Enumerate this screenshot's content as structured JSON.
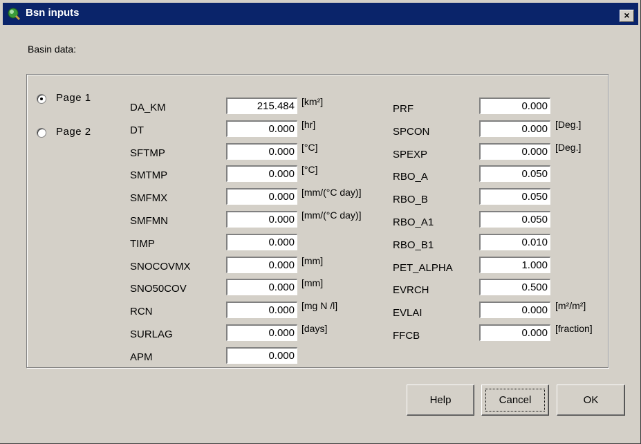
{
  "window": {
    "title": "Bsn inputs",
    "close_glyph": "×",
    "icon": "app-icon"
  },
  "basin_label": "Basin data:",
  "pages": [
    {
      "label": "Page 1",
      "selected": true
    },
    {
      "label": "Page 2",
      "selected": false
    }
  ],
  "left_params": [
    {
      "name": "DA_KM",
      "value": "215.484",
      "unit": "[km²]"
    },
    {
      "name": "DT",
      "value": "0.000",
      "unit": "[hr]"
    },
    {
      "name": "SFTMP",
      "value": "0.000",
      "unit": "[°C]"
    },
    {
      "name": "SMTMP",
      "value": "0.000",
      "unit": "[°C]"
    },
    {
      "name": "SMFMX",
      "value": "0.000",
      "unit": "[mm/(°C day)]"
    },
    {
      "name": "SMFMN",
      "value": "0.000",
      "unit": "[mm/(°C day)]"
    },
    {
      "name": "TIMP",
      "value": "0.000",
      "unit": ""
    },
    {
      "name": "SNOCOVMX",
      "value": "0.000",
      "unit": "[mm]"
    },
    {
      "name": "SNO50COV",
      "value": "0.000",
      "unit": "[mm]"
    },
    {
      "name": "RCN",
      "value": "0.000",
      "unit": "[mg N /l]"
    },
    {
      "name": "SURLAG",
      "value": "0.000",
      "unit": "[days]"
    },
    {
      "name": "APM",
      "value": "0.000",
      "unit": ""
    }
  ],
  "right_params": [
    {
      "name": "PRF",
      "value": "0.000",
      "unit": ""
    },
    {
      "name": "SPCON",
      "value": "0.000",
      "unit": "[Deg.]"
    },
    {
      "name": "SPEXP",
      "value": "0.000",
      "unit": "[Deg.]"
    },
    {
      "name": "RBO_A",
      "value": "0.050",
      "unit": ""
    },
    {
      "name": "RBO_B",
      "value": "0.050",
      "unit": ""
    },
    {
      "name": "RBO_A1",
      "value": "0.050",
      "unit": ""
    },
    {
      "name": "RBO_B1",
      "value": "0.010",
      "unit": ""
    },
    {
      "name": "PET_ALPHA",
      "value": "1.000",
      "unit": ""
    },
    {
      "name": "EVRCH",
      "value": "0.500",
      "unit": ""
    },
    {
      "name": "EVLAI",
      "value": "0.000",
      "unit": "[m²/m²]"
    },
    {
      "name": "FFCB",
      "value": "0.000",
      "unit": "[fraction]"
    }
  ],
  "buttons": {
    "help": "Help",
    "cancel": "Cancel",
    "ok": "OK"
  },
  "colors": {
    "titlebar": "#0a246a",
    "face": "#d4d0c8"
  }
}
